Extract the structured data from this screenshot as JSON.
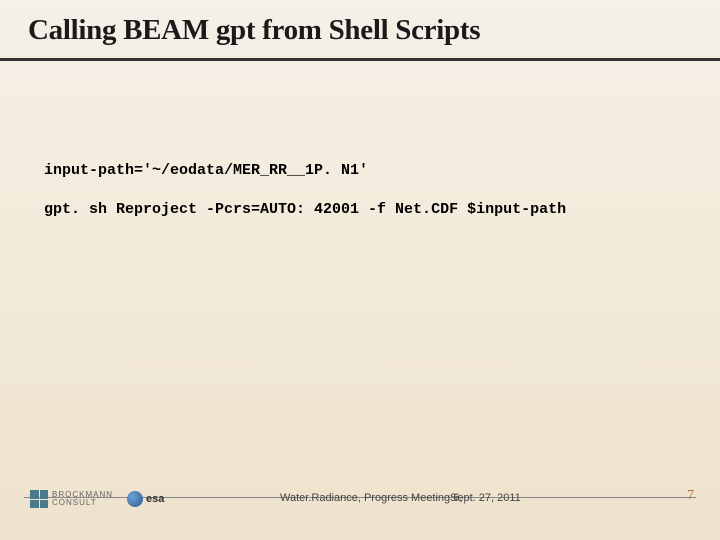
{
  "title": "Calling BEAM gpt from Shell Scripts",
  "code": {
    "line1": "input-path='~/eodata/MER_RR__1P. N1'",
    "line2": "gpt. sh Reproject -Pcrs=AUTO: 42001 -f Net.CDF $input-path"
  },
  "footer": {
    "brockmann_top": "BROCKMANN",
    "brockmann_bottom": "CONSULT",
    "esa": "esa",
    "meeting": "Water.Radiance, Progress Meeting 6,",
    "date": "Sept. 27, 2011",
    "page": "7"
  }
}
